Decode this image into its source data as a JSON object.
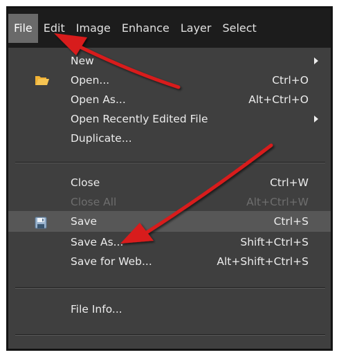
{
  "menubar": {
    "items": [
      "File",
      "Edit",
      "Image",
      "Enhance",
      "Layer",
      "Select"
    ]
  },
  "file_menu": {
    "items": [
      {
        "label": "New",
        "shortcut": "",
        "submenu": true
      },
      {
        "label": "Open...",
        "shortcut": "Ctrl+O",
        "icon": "folder-icon"
      },
      {
        "label": "Open As...",
        "shortcut": "Alt+Ctrl+O"
      },
      {
        "label": "Open Recently Edited File",
        "shortcut": "",
        "submenu": true
      },
      {
        "label": "Duplicate...",
        "shortcut": ""
      },
      {
        "label": "Close",
        "shortcut": "Ctrl+W"
      },
      {
        "label": "Close All",
        "shortcut": "Alt+Ctrl+W",
        "disabled": true
      },
      {
        "label": "Save",
        "shortcut": "Ctrl+S",
        "icon": "floppy-disk-icon",
        "highlighted": true
      },
      {
        "label": "Save As...",
        "shortcut": "Shift+Ctrl+S"
      },
      {
        "label": "Save for Web...",
        "shortcut": "Alt+Shift+Ctrl+S"
      },
      {
        "label": "File Info...",
        "shortcut": ""
      }
    ]
  },
  "colors": {
    "menu_bg": "#3f3f3f",
    "menubar_bg": "#1c1c1c",
    "highlight_bg": "#575757",
    "annotation_arrow": "#d81a1a",
    "folder_icon": "#f2b233"
  }
}
